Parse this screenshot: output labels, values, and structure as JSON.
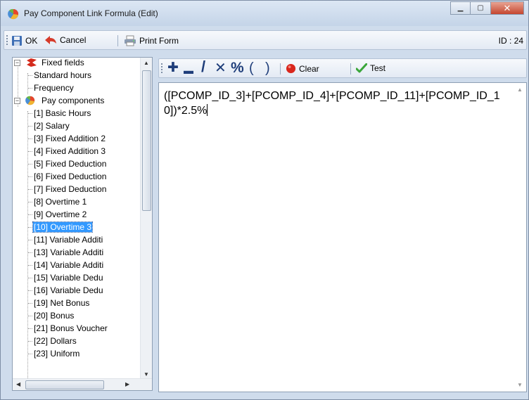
{
  "window": {
    "title": "Pay Component Link Formula (Edit)",
    "minimize_glyph": "▁",
    "maximize_glyph": "▢",
    "close_glyph": "✕"
  },
  "toolbar": {
    "ok_label": "OK",
    "cancel_label": "Cancel",
    "print_label": "Print Form",
    "id_label": "ID : 24"
  },
  "tree": {
    "fixed_fields": {
      "label": "Fixed fields",
      "children": [
        "Standard hours",
        "Frequency"
      ]
    },
    "pay_components": {
      "label": "Pay components",
      "children": [
        "[1] Basic Hours",
        "[2] Salary",
        "[3] Fixed Addition 2",
        "[4] Fixed Addition 3",
        "[5] Fixed Deduction",
        "[6] Fixed Deduction",
        "[7] Fixed Deduction",
        "[8] Overtime 1",
        "[9] Overtime 2",
        "[10] Overtime 3",
        "[11] Variable Additi",
        "[13] Variable Additi",
        "[14] Variable Additi",
        "[15] Variable Dedu",
        "[16] Variable Dedu",
        "[19] Net Bonus",
        "[20] Bonus",
        "[21] Bonus Voucher",
        "[22] Dollars",
        "[23] Uniform"
      ],
      "selected": "[10] Overtime 3"
    }
  },
  "editor_toolbar": {
    "add_glyph": "✚",
    "subtract_glyph": "▬",
    "divide_glyph": "/",
    "multiply_glyph": "✕",
    "percent_glyph": "%",
    "open_paren": "(",
    "close_paren": ")",
    "clear_label": "Clear",
    "test_label": "Test"
  },
  "formula": {
    "text": "([PCOMP_ID_3]+[PCOMP_ID_4]+[PCOMP_ID_11]+[PCOMP_ID_10])*2.5%"
  },
  "colors": {
    "accent": "#3399ff",
    "operator": "#1f3e7a",
    "clear_dot": "#d9261c",
    "test_check": "#3aa63a"
  }
}
